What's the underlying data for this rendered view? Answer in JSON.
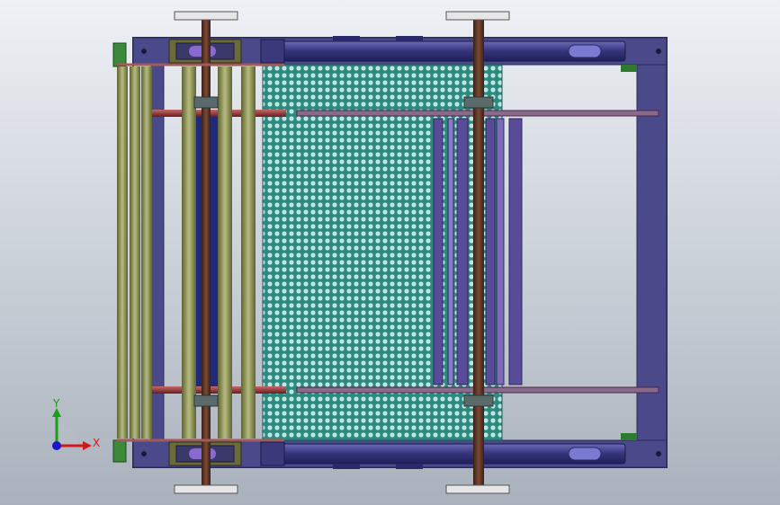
{
  "triad": {
    "x_label": "X",
    "y_label": "Y"
  },
  "colors": {
    "background_top": "#eef1f5",
    "background_bottom": "#a9b1bc",
    "frame": "#4a4a8a",
    "frame_dark": "#2a2a5a",
    "roller": "#8a8f5a",
    "rod": "#9a3a3a",
    "shaft": "#6a3a2a",
    "mesh": "#2d8a80",
    "mesh_hole": "#bfe6e0",
    "cylinder": "#3c3c86",
    "x_axis": "#d01818",
    "y_axis": "#18a018",
    "z_axis": "#1818c8"
  },
  "icons": {
    "triad": "xyz-triad-icon"
  }
}
